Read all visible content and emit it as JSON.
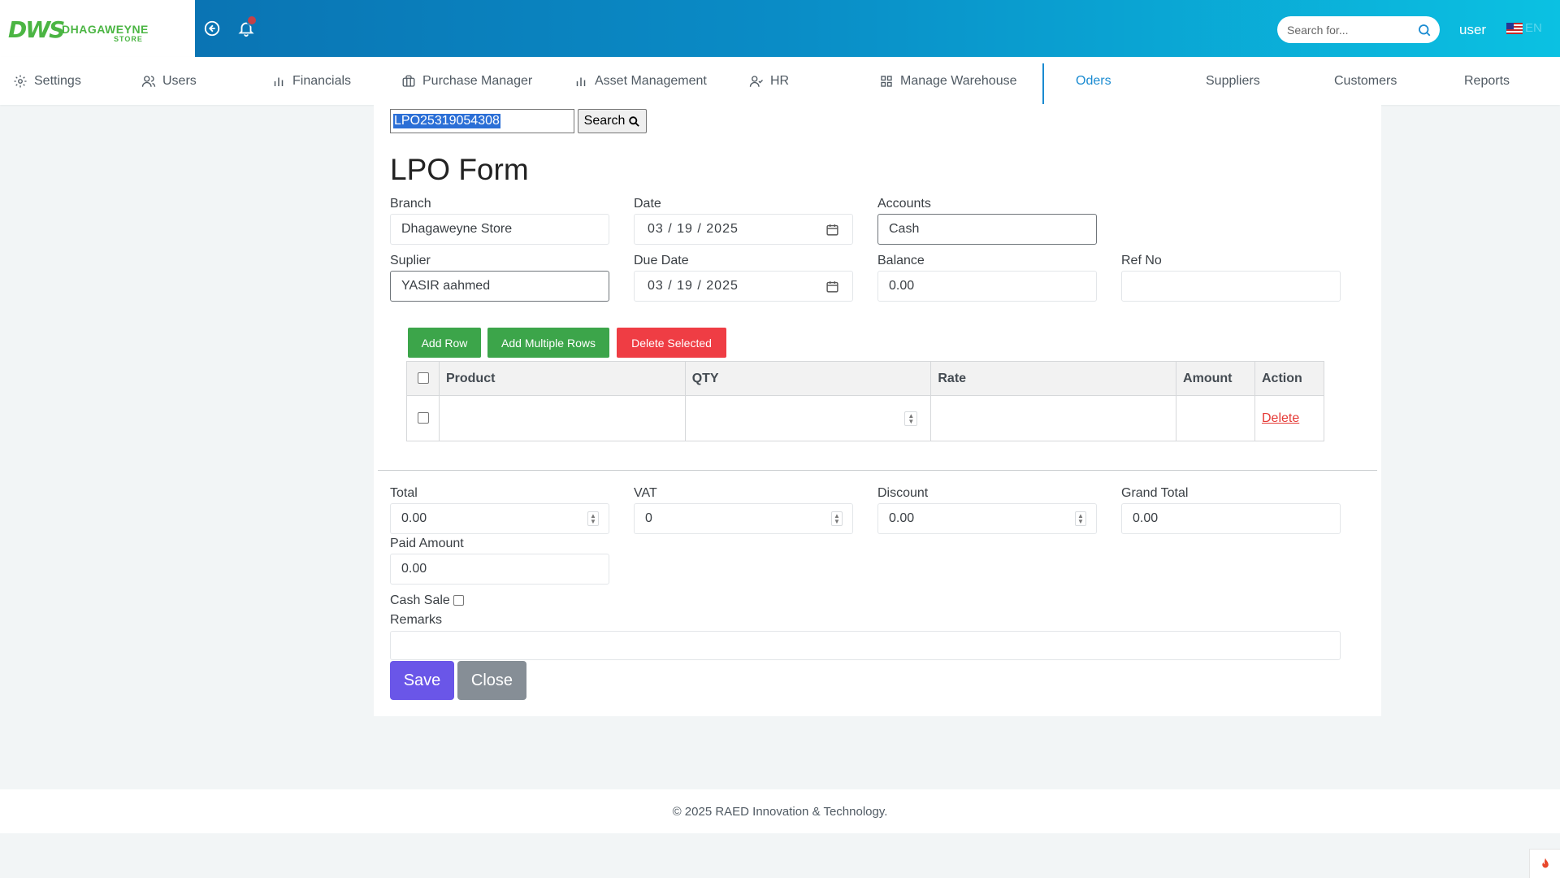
{
  "brand": {
    "mark": "DWS",
    "name": "DHAGAWEYNE",
    "sub": "STORE"
  },
  "header": {
    "search_placeholder": "Search for...",
    "user": "user",
    "lang": "EN"
  },
  "nav": {
    "items": [
      {
        "label": "Settings",
        "icon": "gear-icon"
      },
      {
        "label": "Users",
        "icon": "users-icon"
      },
      {
        "label": "Financials",
        "icon": "bar-chart-icon"
      },
      {
        "label": "Purchase Manager",
        "icon": "briefcase-icon"
      },
      {
        "label": "Asset Management",
        "icon": "bar-chart-icon"
      },
      {
        "label": "HR",
        "icon": "user-check-icon"
      },
      {
        "label": "Manage Warehouse",
        "icon": "grid-icon"
      },
      {
        "label": "Oders"
      },
      {
        "label": "Suppliers"
      },
      {
        "label": "Customers"
      },
      {
        "label": "Reports"
      }
    ],
    "active": "Oders"
  },
  "lookup": {
    "value": "LPO25319054308",
    "button": "Search"
  },
  "form": {
    "title": "LPO Form",
    "branch": {
      "label": "Branch",
      "value": "Dhagaweyne Store"
    },
    "date": {
      "label": "Date",
      "value": "03 / 19 / 2025"
    },
    "accounts": {
      "label": "Accounts",
      "value": "Cash"
    },
    "supplier": {
      "label": "Suplier",
      "value": "YASIR aahmed"
    },
    "due_date": {
      "label": "Due Date",
      "value": "03 / 19 / 2025"
    },
    "balance": {
      "label": "Balance",
      "value": "0.00"
    },
    "ref_no": {
      "label": "Ref No",
      "value": ""
    }
  },
  "actions": {
    "add_row": "Add Row",
    "add_multiple": "Add Multiple Rows",
    "delete_selected": "Delete Selected"
  },
  "table": {
    "columns": [
      "Product",
      "QTY",
      "Rate",
      "Amount",
      "Action"
    ],
    "rows": [
      {
        "product": "",
        "qty": "",
        "rate": "",
        "amount": "",
        "action": "Delete"
      }
    ]
  },
  "totals": {
    "total": {
      "label": "Total",
      "value": "0.00"
    },
    "vat": {
      "label": "VAT",
      "value": "0"
    },
    "discount": {
      "label": "Discount",
      "value": "0.00"
    },
    "grand_total": {
      "label": "Grand Total",
      "value": "0.00"
    },
    "paid_amount": {
      "label": "Paid Amount",
      "value": "0.00"
    },
    "cash_sale": {
      "label": "Cash Sale",
      "checked": false
    },
    "remarks": {
      "label": "Remarks",
      "value": ""
    }
  },
  "buttons": {
    "save": "Save",
    "close": "Close"
  },
  "footer": {
    "text": "© 2025 RAED Innovation & Technology."
  },
  "colors": {
    "accent": "#1a8bd1",
    "green": "#3ca54a",
    "red": "#ef3d44",
    "save": "#6a56e8",
    "close": "#868e96"
  }
}
